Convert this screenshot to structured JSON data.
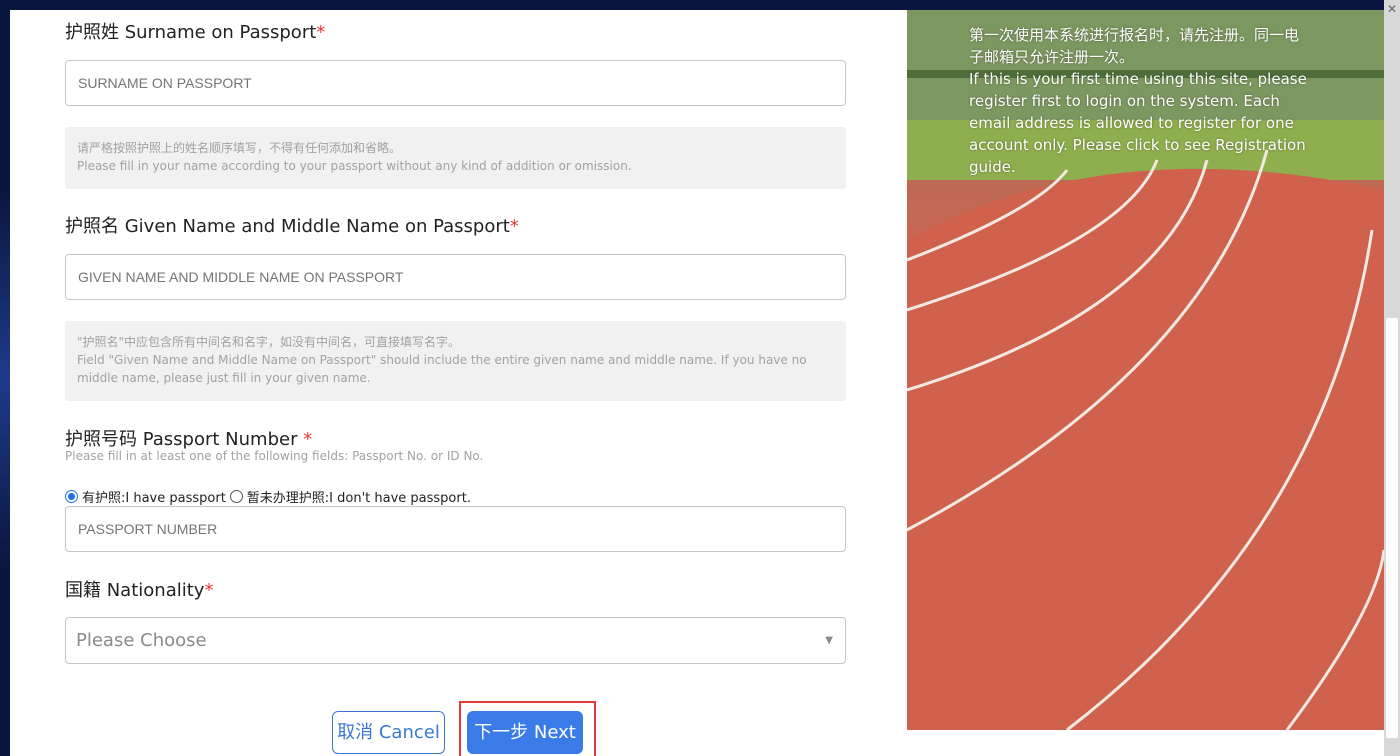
{
  "surname": {
    "label": "护照姓 Surname on Passport",
    "required": "*",
    "placeholder": "SURNAME ON PASSPORT",
    "hint_cn": "请严格按照护照上的姓名顺序填写，不得有任何添加和省略。",
    "hint_en": "Please fill in your name according to your passport without any kind of addition or omission."
  },
  "given_name": {
    "label": "护照名 Given Name and Middle Name on Passport",
    "required": "*",
    "placeholder": "GIVEN NAME AND MIDDLE NAME ON PASSPORT",
    "hint_cn": "\"护照名\"中应包含所有中间名和名字，如没有中间名，可直接填写名字。",
    "hint_en": "Field \"Given Name and Middle Name on Passport\" should include the entire given name and middle name. If you have no middle name, please just fill in your given name."
  },
  "passport": {
    "label": "护照号码 Passport Number",
    "required": "*",
    "hint": "Please fill in at least one of the following fields: Passport No. or ID No.",
    "option_have": "有护照:I have passport",
    "option_none": "暂未办理护照:I don't have passport.",
    "selected": "have",
    "placeholder": "PASSPORT NUMBER"
  },
  "nationality": {
    "label": "国籍 Nationality",
    "required": "*",
    "placeholder": "Please Choose"
  },
  "buttons": {
    "cancel": "取消 Cancel",
    "next": "下一步 Next"
  },
  "side_panel": {
    "text_cn": "第一次使用本系统进行报名时，请先注册。同一电子邮箱只允许注册一次。",
    "text_en": "If this is your first time using this site, please register first to login on the system. Each email address is allowed to register for one account only. Please click to see Registration guide."
  },
  "colors": {
    "accent": "#3b7be8",
    "required": "#e53935",
    "highlight": "#e53935"
  }
}
